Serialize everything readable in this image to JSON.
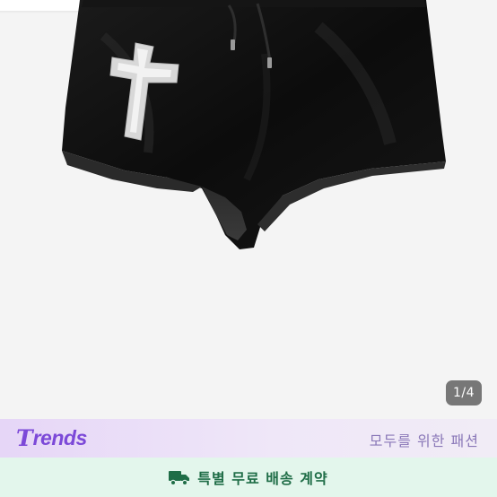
{
  "gallery": {
    "image_alt": "black velvet shorts with rhinestone cross",
    "page_indicator": "1/4"
  },
  "trends_banner": {
    "logo_text": "rends",
    "logo_letter": "T",
    "tagline": "모두를 위한 패션",
    "accent_color": "#7c49d8"
  },
  "shipping": {
    "icon": "delivery-truck-icon",
    "label": "특별 무료 배송 계약",
    "color": "#1f6d47"
  }
}
